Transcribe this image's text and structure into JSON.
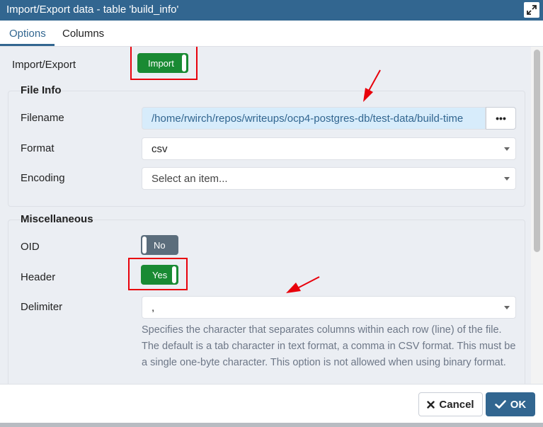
{
  "dialog": {
    "title": "Import/Export data - table 'build_info'"
  },
  "tabs": [
    {
      "label": "Options",
      "active": true
    },
    {
      "label": "Columns",
      "active": false
    }
  ],
  "import_export": {
    "label": "Import/Export",
    "toggle_text": "Import",
    "state": "on"
  },
  "file_info": {
    "legend": "File Info",
    "filename_label": "Filename",
    "filename_value": "/home/rwirch/repos/writeups/ocp4-postgres-db/test-data/build-time",
    "browse_label": "•••",
    "format_label": "Format",
    "format_value": "csv",
    "encoding_label": "Encoding",
    "encoding_placeholder": "Select an item..."
  },
  "misc": {
    "legend": "Miscellaneous",
    "oid_label": "OID",
    "oid_toggle": "No",
    "header_label": "Header",
    "header_toggle": "Yes",
    "delimiter_label": "Delimiter",
    "delimiter_value": ",",
    "delimiter_help": "Specifies the character that separates columns within each row (line) of the file. The default is a tab character in text format, a comma in CSV format. This must be a single one-byte character. This option is not allowed when using binary format."
  },
  "footer": {
    "cancel_label": "Cancel",
    "ok_label": "OK"
  },
  "colors": {
    "title_bar": "#326690",
    "toggle_on": "#198a33",
    "toggle_off": "#5b6d7c",
    "annotation": "#e8000b"
  }
}
